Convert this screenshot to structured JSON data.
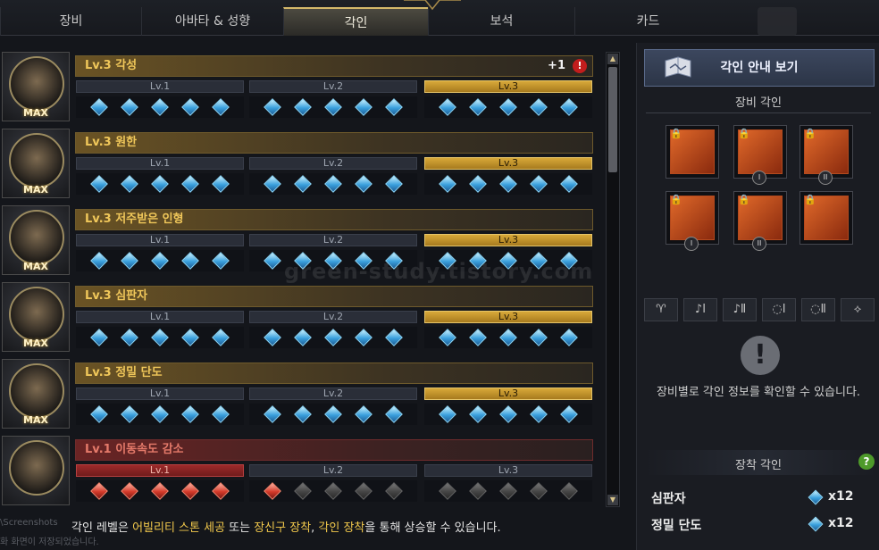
{
  "tabs": [
    {
      "label": "장비",
      "active": false
    },
    {
      "label": "아바타 & 성향",
      "active": false
    },
    {
      "label": "각인",
      "active": true
    },
    {
      "label": "보석",
      "active": false
    },
    {
      "label": "카드",
      "active": false
    }
  ],
  "engravings": [
    {
      "title": "Lv.3 각성",
      "badge": "MAX",
      "plus": "+1",
      "alert": "!",
      "active_level": 3,
      "levels": [
        "Lv.1",
        "Lv.2",
        "Lv.3"
      ],
      "gem_color": "blue"
    },
    {
      "title": "Lv.3 원한",
      "badge": "MAX",
      "active_level": 3,
      "levels": [
        "Lv.1",
        "Lv.2",
        "Lv.3"
      ],
      "gem_color": "blue"
    },
    {
      "title": "Lv.3 저주받은 인형",
      "badge": "MAX",
      "active_level": 3,
      "levels": [
        "Lv.1",
        "Lv.2",
        "Lv.3"
      ],
      "gem_color": "blue"
    },
    {
      "title": "Lv.3 심판자",
      "badge": "MAX",
      "active_level": 3,
      "levels": [
        "Lv.1",
        "Lv.2",
        "Lv.3"
      ],
      "gem_color": "blue"
    },
    {
      "title": "Lv.3 정밀 단도",
      "badge": "MAX",
      "active_level": 3,
      "levels": [
        "Lv.1",
        "Lv.2",
        "Lv.3"
      ],
      "gem_color": "blue"
    },
    {
      "title": "Lv.1 이동속도 감소",
      "badge": "",
      "active_level": 1,
      "levels": [
        "Lv.1",
        "Lv.2",
        "Lv.3"
      ],
      "gem_color": "red",
      "filled_gems": 6
    }
  ],
  "footer": {
    "part1": "각인 레벨은 ",
    "hl1": "어빌리티 스톤 세공",
    "part2": " 또는 ",
    "hl2": "장신구 장착",
    "part3": ", ",
    "hl3": "각인 장착",
    "part4": "을 통해 상승할 수 있습니다."
  },
  "watermarks": {
    "center": "green-study.tistory.com",
    "bottom_left_1": "\\Screenshots",
    "bottom_left_2": "화 화면이 저장되었습니다."
  },
  "right_panel": {
    "guide_button": "각인 안내 보기",
    "equipment_section": "장비 각인",
    "slots": [
      {
        "icon": "necklace-icon",
        "roman": ""
      },
      {
        "icon": "earring-icon",
        "roman": "I"
      },
      {
        "icon": "earring-icon",
        "roman": "II"
      },
      {
        "icon": "ring-icon",
        "roman": "I"
      },
      {
        "icon": "ring-icon",
        "roman": "II"
      },
      {
        "icon": "ability-stone-icon",
        "roman": ""
      }
    ],
    "filters": [
      "necklace-filter-icon",
      "earring-1-filter-icon",
      "earring-2-filter-icon",
      "ring-1-filter-icon",
      "ring-2-filter-icon",
      "stone-filter-icon"
    ],
    "filter_glyphs": [
      "♈",
      "♪Ⅰ",
      "♪Ⅱ",
      "◌Ⅰ",
      "◌Ⅱ",
      "⟡"
    ],
    "info_mark": "!",
    "info_text": "장비별로 각인 정보를 확인할 수 있습니다.",
    "equipped_section": "장착 각인",
    "help": "?",
    "equipped": [
      {
        "name": "심판자",
        "count": "x12"
      },
      {
        "name": "정밀 단도",
        "count": "x12"
      }
    ]
  },
  "colors": {
    "accent_gold": "#f0c75a",
    "active_level": "#d8a939",
    "penalty_red": "#e57a6a",
    "gem_blue": "#3aa0dd"
  }
}
